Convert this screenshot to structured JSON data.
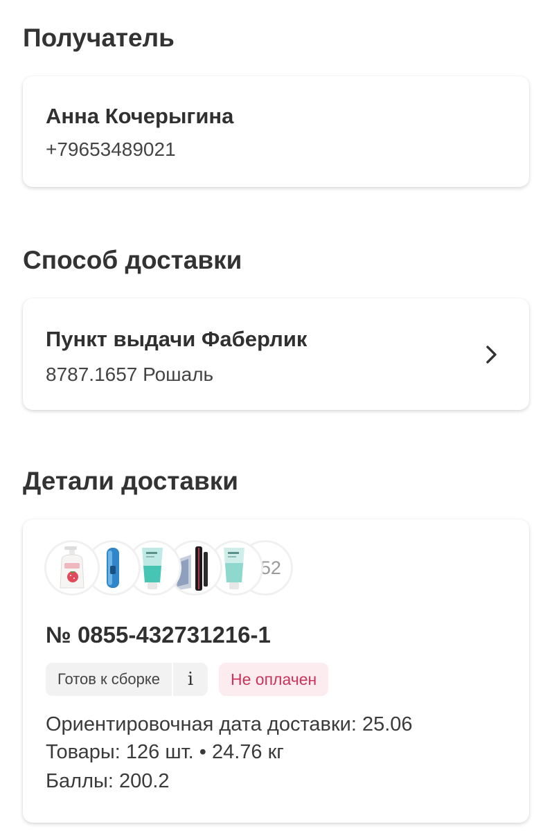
{
  "recipient": {
    "section_title": "Получатель",
    "name": "Анна Кочерыгина",
    "phone": "+79653489021"
  },
  "delivery_method": {
    "section_title": "Способ доставки",
    "name": "Пункт выдачи Фаберлик",
    "address": "8787.1657 Рошаль",
    "chevron_icon": "chevron-right-icon"
  },
  "delivery_details": {
    "section_title": "Детали доставки",
    "product_thumbnails": [
      "hand-soap-product",
      "blue-perfume-product",
      "teal-tube-product",
      "mascara-product",
      "teal-tube-product"
    ],
    "more_count": "+52",
    "order_number": "№ 0855-432731216-1",
    "status_label": "Готов к сборке",
    "info_icon_label": "i",
    "payment_status": "Не оплачен",
    "estimated_date": "Ориентировочная дата доставки: 25.06",
    "goods": "Товары: 126 шт. • 24.76 кг",
    "points": "Баллы: 200.2"
  },
  "colors": {
    "unpaid_text": "#c9345b",
    "unpaid_bg": "#fcebef",
    "badge_bg": "#f2f2f2"
  }
}
